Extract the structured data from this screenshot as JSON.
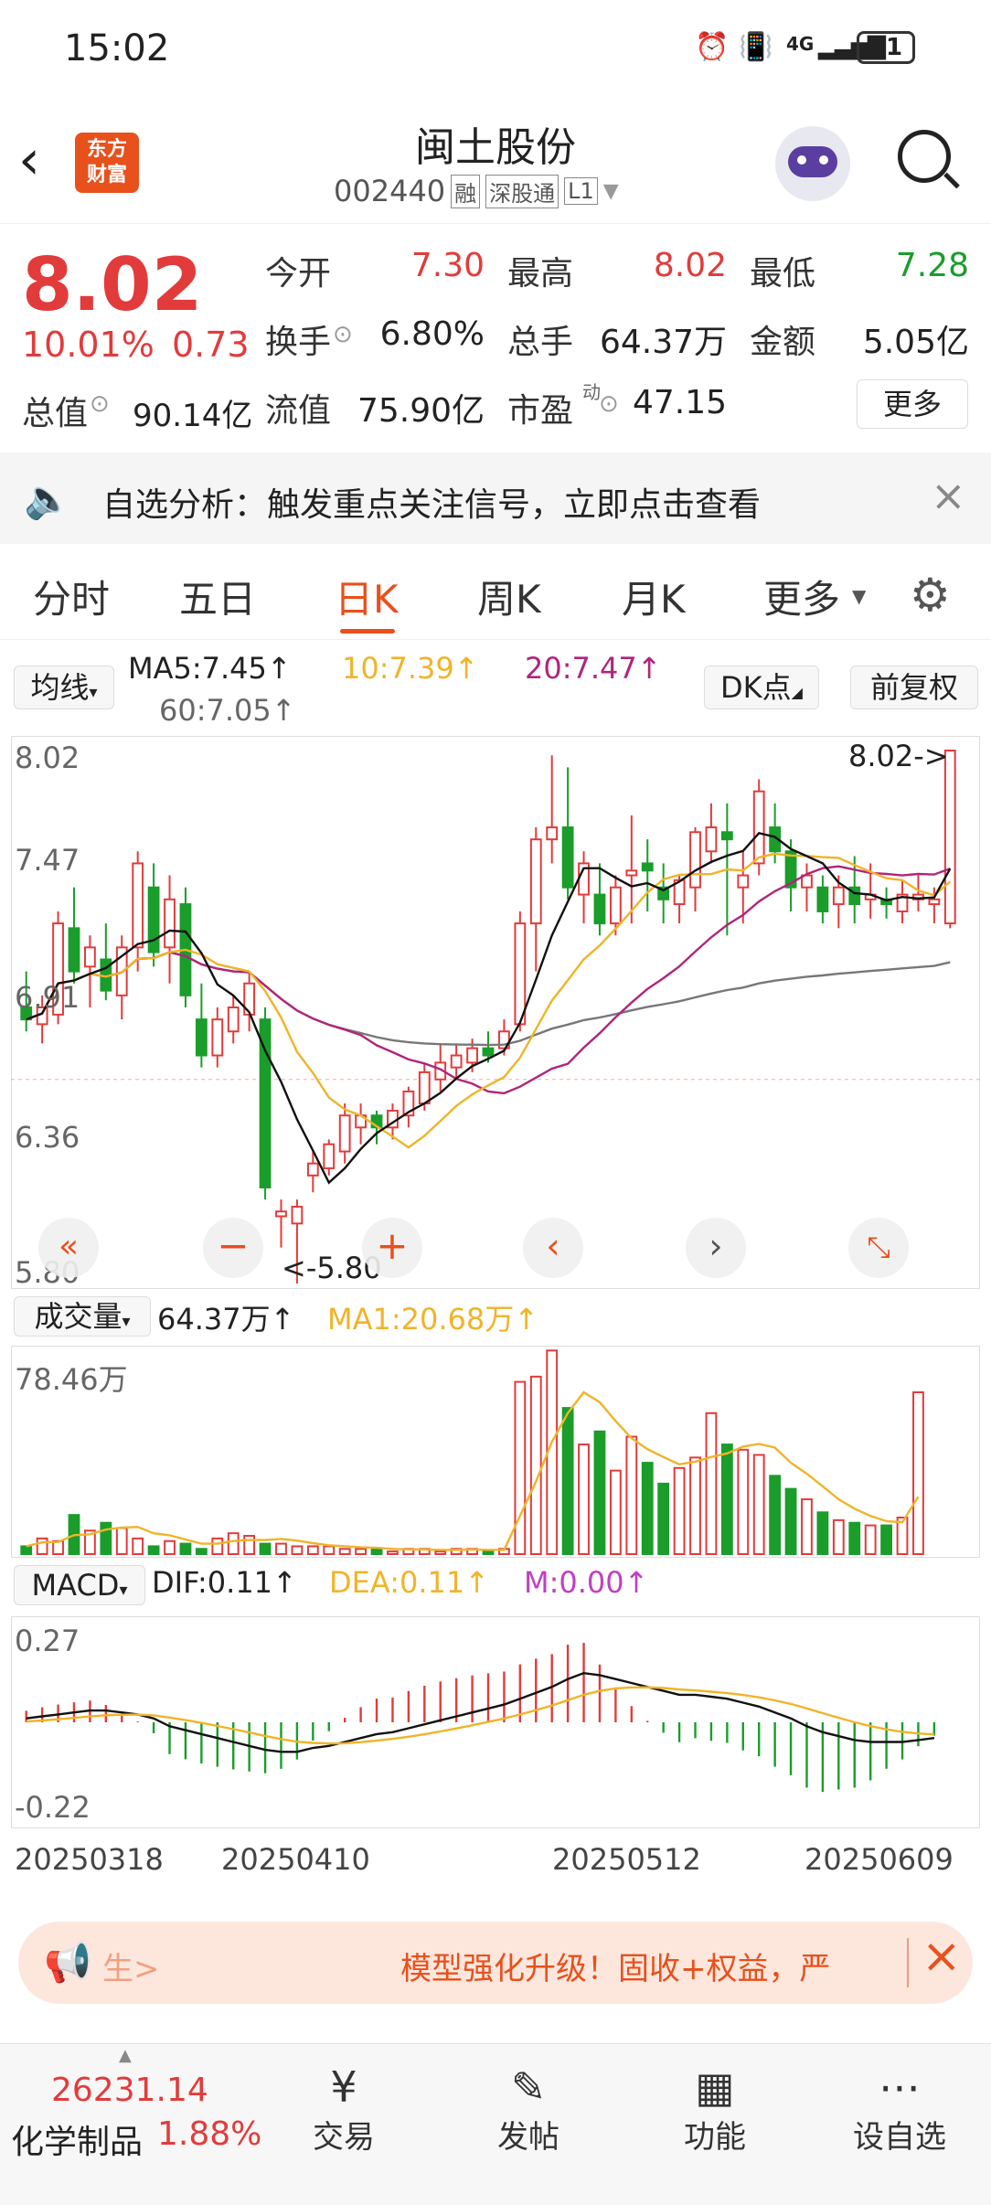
{
  "status": {
    "time": "15:02",
    "network": "4G",
    "battery": "91"
  },
  "header": {
    "title": "闽土股份",
    "code": "002440",
    "tags": [
      "融",
      "深股通",
      "L1"
    ],
    "logo_line1": "东方",
    "logo_line2": "财富"
  },
  "quote": {
    "price": "8.02",
    "change_pct": "10.01%",
    "change": "0.73",
    "open_label": "今开",
    "open": "7.30",
    "high_label": "最高",
    "high": "8.02",
    "low_label": "最低",
    "low": "7.28",
    "turnover_label": "换手",
    "turnover": "6.80%",
    "volume_label": "总手",
    "volume": "64.37万",
    "amount_label": "金额",
    "amount": "5.05亿",
    "mcap_label": "总值",
    "mcap": "90.14亿",
    "float_label": "流值",
    "float": "75.90亿",
    "pe_label": "市盈",
    "pe_sup": "动",
    "pe": "47.15",
    "more": "更多"
  },
  "notice": {
    "text": "自选分析：触发重点关注信号，立即点击查看"
  },
  "tabs": [
    "分时",
    "五日",
    "日K",
    "周K",
    "月K",
    "更多"
  ],
  "ma": {
    "selector": "均线",
    "ma5": "MA5:7.45↑",
    "ma10": "10:7.39↑",
    "ma20": "20:7.47↑",
    "ma60": "60:7.05↑",
    "dk": "DK点",
    "fq": "前复权"
  },
  "kline": {
    "y_top": "8.02",
    "y_2": "7.47",
    "y_3": "6.91",
    "y_4": "6.36",
    "y_bottom": "5.80",
    "max_label": "8.02->",
    "min_label": "<-5.80"
  },
  "vol": {
    "selector": "成交量",
    "value": "64.37万↑",
    "ma1": "MA1:20.68万↑",
    "y_top": "78.46万"
  },
  "macd": {
    "selector": "MACD",
    "dif": "DIF:0.11↑",
    "dea": "DEA:0.11↑",
    "m": "M:0.00↑",
    "y_top": "0.27",
    "y_bottom": "-0.22"
  },
  "dates": [
    "20250318",
    "20250410",
    "20250512",
    "20250609"
  ],
  "banner": {
    "left": "生>",
    "text": "模型强化升级！固收+权益，严"
  },
  "footer": {
    "index_value": "26231.14",
    "index_name": "化学制品",
    "index_pct": "1.88%",
    "btn1": "交易",
    "btn2": "发帖",
    "btn3": "功能",
    "btn4": "设自选"
  },
  "colors": {
    "up": "#e23b3b",
    "down": "#1a9d2a",
    "accent": "#e8501c",
    "ma5": "#111111",
    "ma10": "#f0b429",
    "ma20": "#b0257a",
    "ma60": "#777777"
  },
  "chart_data": {
    "type": "candlestick",
    "ylim": [
      5.8,
      8.02
    ],
    "candles": [
      {
        "o": 6.95,
        "h": 7.1,
        "l": 6.85,
        "c": 6.9
      },
      {
        "o": 6.88,
        "h": 7.0,
        "l": 6.8,
        "c": 6.95
      },
      {
        "o": 6.92,
        "h": 7.35,
        "l": 6.88,
        "c": 7.3
      },
      {
        "o": 7.28,
        "h": 7.45,
        "l": 7.05,
        "c": 7.1
      },
      {
        "o": 7.12,
        "h": 7.25,
        "l": 6.95,
        "c": 7.2
      },
      {
        "o": 7.15,
        "h": 7.3,
        "l": 6.98,
        "c": 7.02
      },
      {
        "o": 7.0,
        "h": 7.25,
        "l": 6.9,
        "c": 7.2
      },
      {
        "o": 7.2,
        "h": 7.6,
        "l": 7.1,
        "c": 7.55
      },
      {
        "o": 7.45,
        "h": 7.55,
        "l": 7.12,
        "c": 7.18
      },
      {
        "o": 7.2,
        "h": 7.5,
        "l": 7.05,
        "c": 7.4
      },
      {
        "o": 7.38,
        "h": 7.45,
        "l": 6.95,
        "c": 7.0
      },
      {
        "o": 6.9,
        "h": 7.05,
        "l": 6.7,
        "c": 6.75
      },
      {
        "o": 6.75,
        "h": 6.95,
        "l": 6.7,
        "c": 6.9
      },
      {
        "o": 6.85,
        "h": 7.0,
        "l": 6.8,
        "c": 6.95
      },
      {
        "o": 6.92,
        "h": 7.1,
        "l": 6.85,
        "c": 7.05
      },
      {
        "o": 6.9,
        "h": 6.95,
        "l": 6.15,
        "c": 6.2
      },
      {
        "o": 6.08,
        "h": 6.15,
        "l": 5.95,
        "c": 6.1
      },
      {
        "o": 6.05,
        "h": 6.15,
        "l": 5.8,
        "c": 6.12
      },
      {
        "o": 6.25,
        "h": 6.35,
        "l": 6.18,
        "c": 6.3
      },
      {
        "o": 6.28,
        "h": 6.4,
        "l": 6.25,
        "c": 6.38
      },
      {
        "o": 6.35,
        "h": 6.55,
        "l": 6.3,
        "c": 6.5
      },
      {
        "o": 6.45,
        "h": 6.55,
        "l": 6.38,
        "c": 6.5
      },
      {
        "o": 6.5,
        "h": 6.52,
        "l": 6.38,
        "c": 6.45
      },
      {
        "o": 6.45,
        "h": 6.55,
        "l": 6.4,
        "c": 6.52
      },
      {
        "o": 6.5,
        "h": 6.62,
        "l": 6.45,
        "c": 6.6
      },
      {
        "o": 6.55,
        "h": 6.72,
        "l": 6.52,
        "c": 6.68
      },
      {
        "o": 6.65,
        "h": 6.8,
        "l": 6.6,
        "c": 6.72
      },
      {
        "o": 6.7,
        "h": 6.8,
        "l": 6.65,
        "c": 6.75
      },
      {
        "o": 6.72,
        "h": 6.82,
        "l": 6.68,
        "c": 6.78
      },
      {
        "o": 6.78,
        "h": 6.85,
        "l": 6.72,
        "c": 6.75
      },
      {
        "o": 6.78,
        "h": 6.9,
        "l": 6.75,
        "c": 6.85
      },
      {
        "o": 6.88,
        "h": 7.35,
        "l": 6.85,
        "c": 7.3
      },
      {
        "o": 7.3,
        "h": 7.7,
        "l": 7.1,
        "c": 7.65
      },
      {
        "o": 7.65,
        "h": 8.0,
        "l": 7.55,
        "c": 7.7
      },
      {
        "o": 7.7,
        "h": 7.95,
        "l": 7.4,
        "c": 7.45
      },
      {
        "o": 7.42,
        "h": 7.6,
        "l": 7.3,
        "c": 7.55
      },
      {
        "o": 7.42,
        "h": 7.55,
        "l": 7.25,
        "c": 7.3
      },
      {
        "o": 7.3,
        "h": 7.5,
        "l": 7.25,
        "c": 7.45
      },
      {
        "o": 7.5,
        "h": 7.75,
        "l": 7.3,
        "c": 7.52
      },
      {
        "o": 7.55,
        "h": 7.65,
        "l": 7.35,
        "c": 7.52
      },
      {
        "o": 7.45,
        "h": 7.55,
        "l": 7.3,
        "c": 7.4
      },
      {
        "o": 7.38,
        "h": 7.5,
        "l": 7.3,
        "c": 7.48
      },
      {
        "o": 7.45,
        "h": 7.7,
        "l": 7.35,
        "c": 7.68
      },
      {
        "o": 7.6,
        "h": 7.8,
        "l": 7.55,
        "c": 7.7
      },
      {
        "o": 7.68,
        "h": 7.8,
        "l": 7.25,
        "c": 7.65
      },
      {
        "o": 7.45,
        "h": 7.6,
        "l": 7.3,
        "c": 7.5
      },
      {
        "o": 7.55,
        "h": 7.9,
        "l": 7.5,
        "c": 7.85
      },
      {
        "o": 7.7,
        "h": 7.8,
        "l": 7.55,
        "c": 7.6
      },
      {
        "o": 7.6,
        "h": 7.65,
        "l": 7.35,
        "c": 7.45
      },
      {
        "o": 7.45,
        "h": 7.55,
        "l": 7.35,
        "c": 7.5
      },
      {
        "o": 7.45,
        "h": 7.5,
        "l": 7.3,
        "c": 7.35
      },
      {
        "o": 7.38,
        "h": 7.5,
        "l": 7.28,
        "c": 7.45
      },
      {
        "o": 7.45,
        "h": 7.58,
        "l": 7.3,
        "c": 7.38
      },
      {
        "o": 7.4,
        "h": 7.55,
        "l": 7.32,
        "c": 7.42
      },
      {
        "o": 7.4,
        "h": 7.45,
        "l": 7.32,
        "c": 7.38
      },
      {
        "o": 7.35,
        "h": 7.48,
        "l": 7.3,
        "c": 7.42
      },
      {
        "o": 7.4,
        "h": 7.5,
        "l": 7.35,
        "c": 7.42
      },
      {
        "o": 7.38,
        "h": 7.45,
        "l": 7.3,
        "c": 7.4
      },
      {
        "o": 7.3,
        "h": 8.02,
        "l": 7.28,
        "c": 8.02
      }
    ],
    "volume": [
      3,
      6,
      5,
      15,
      9,
      12,
      10,
      6,
      3,
      5,
      4,
      2,
      6,
      8,
      7,
      4,
      4,
      3,
      3,
      3,
      2,
      2,
      2,
      1,
      2,
      2,
      1,
      2,
      2,
      1,
      2,
      66,
      68,
      78,
      56,
      42,
      47,
      32,
      45,
      35,
      27,
      33,
      37,
      54,
      42,
      40,
      38,
      30,
      25,
      21,
      16,
      13,
      12,
      11,
      11,
      14,
      62
    ],
    "macd": [
      0.02,
      0.03,
      0.04,
      0.05,
      0.06,
      0.06,
      0.05,
      0.04,
      0.02,
      -0.02,
      -0.04,
      -0.06,
      -0.08,
      -0.1,
      -0.12,
      -0.14,
      -0.15,
      -0.15,
      -0.13,
      -0.12,
      -0.1,
      -0.08,
      -0.06,
      -0.05,
      -0.03,
      -0.01,
      0.01,
      0.03,
      0.05,
      0.07,
      0.09,
      0.12,
      0.15,
      0.18,
      0.22,
      0.25,
      0.24,
      0.22,
      0.2,
      0.18,
      0.16,
      0.14,
      0.14,
      0.13,
      0.12,
      0.1,
      0.08,
      0.05,
      0.02,
      -0.02,
      -0.05,
      -0.07,
      -0.09,
      -0.1,
      -0.1,
      -0.1,
      -0.09,
      -0.08
    ]
  }
}
